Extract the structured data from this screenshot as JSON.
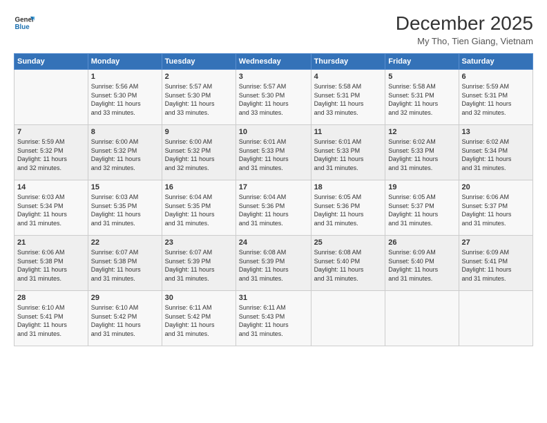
{
  "header": {
    "logo_line1": "General",
    "logo_line2": "Blue",
    "title": "December 2025",
    "location": "My Tho, Tien Giang, Vietnam"
  },
  "days_of_week": [
    "Sunday",
    "Monday",
    "Tuesday",
    "Wednesday",
    "Thursday",
    "Friday",
    "Saturday"
  ],
  "weeks": [
    [
      {
        "day": "",
        "info": ""
      },
      {
        "day": "1",
        "info": "Sunrise: 5:56 AM\nSunset: 5:30 PM\nDaylight: 11 hours\nand 33 minutes."
      },
      {
        "day": "2",
        "info": "Sunrise: 5:57 AM\nSunset: 5:30 PM\nDaylight: 11 hours\nand 33 minutes."
      },
      {
        "day": "3",
        "info": "Sunrise: 5:57 AM\nSunset: 5:30 PM\nDaylight: 11 hours\nand 33 minutes."
      },
      {
        "day": "4",
        "info": "Sunrise: 5:58 AM\nSunset: 5:31 PM\nDaylight: 11 hours\nand 33 minutes."
      },
      {
        "day": "5",
        "info": "Sunrise: 5:58 AM\nSunset: 5:31 PM\nDaylight: 11 hours\nand 32 minutes."
      },
      {
        "day": "6",
        "info": "Sunrise: 5:59 AM\nSunset: 5:31 PM\nDaylight: 11 hours\nand 32 minutes."
      }
    ],
    [
      {
        "day": "7",
        "info": "Sunrise: 5:59 AM\nSunset: 5:32 PM\nDaylight: 11 hours\nand 32 minutes."
      },
      {
        "day": "8",
        "info": "Sunrise: 6:00 AM\nSunset: 5:32 PM\nDaylight: 11 hours\nand 32 minutes."
      },
      {
        "day": "9",
        "info": "Sunrise: 6:00 AM\nSunset: 5:32 PM\nDaylight: 11 hours\nand 32 minutes."
      },
      {
        "day": "10",
        "info": "Sunrise: 6:01 AM\nSunset: 5:33 PM\nDaylight: 11 hours\nand 31 minutes."
      },
      {
        "day": "11",
        "info": "Sunrise: 6:01 AM\nSunset: 5:33 PM\nDaylight: 11 hours\nand 31 minutes."
      },
      {
        "day": "12",
        "info": "Sunrise: 6:02 AM\nSunset: 5:33 PM\nDaylight: 11 hours\nand 31 minutes."
      },
      {
        "day": "13",
        "info": "Sunrise: 6:02 AM\nSunset: 5:34 PM\nDaylight: 11 hours\nand 31 minutes."
      }
    ],
    [
      {
        "day": "14",
        "info": "Sunrise: 6:03 AM\nSunset: 5:34 PM\nDaylight: 11 hours\nand 31 minutes."
      },
      {
        "day": "15",
        "info": "Sunrise: 6:03 AM\nSunset: 5:35 PM\nDaylight: 11 hours\nand 31 minutes."
      },
      {
        "day": "16",
        "info": "Sunrise: 6:04 AM\nSunset: 5:35 PM\nDaylight: 11 hours\nand 31 minutes."
      },
      {
        "day": "17",
        "info": "Sunrise: 6:04 AM\nSunset: 5:36 PM\nDaylight: 11 hours\nand 31 minutes."
      },
      {
        "day": "18",
        "info": "Sunrise: 6:05 AM\nSunset: 5:36 PM\nDaylight: 11 hours\nand 31 minutes."
      },
      {
        "day": "19",
        "info": "Sunrise: 6:05 AM\nSunset: 5:37 PM\nDaylight: 11 hours\nand 31 minutes."
      },
      {
        "day": "20",
        "info": "Sunrise: 6:06 AM\nSunset: 5:37 PM\nDaylight: 11 hours\nand 31 minutes."
      }
    ],
    [
      {
        "day": "21",
        "info": "Sunrise: 6:06 AM\nSunset: 5:38 PM\nDaylight: 11 hours\nand 31 minutes."
      },
      {
        "day": "22",
        "info": "Sunrise: 6:07 AM\nSunset: 5:38 PM\nDaylight: 11 hours\nand 31 minutes."
      },
      {
        "day": "23",
        "info": "Sunrise: 6:07 AM\nSunset: 5:39 PM\nDaylight: 11 hours\nand 31 minutes."
      },
      {
        "day": "24",
        "info": "Sunrise: 6:08 AM\nSunset: 5:39 PM\nDaylight: 11 hours\nand 31 minutes."
      },
      {
        "day": "25",
        "info": "Sunrise: 6:08 AM\nSunset: 5:40 PM\nDaylight: 11 hours\nand 31 minutes."
      },
      {
        "day": "26",
        "info": "Sunrise: 6:09 AM\nSunset: 5:40 PM\nDaylight: 11 hours\nand 31 minutes."
      },
      {
        "day": "27",
        "info": "Sunrise: 6:09 AM\nSunset: 5:41 PM\nDaylight: 11 hours\nand 31 minutes."
      }
    ],
    [
      {
        "day": "28",
        "info": "Sunrise: 6:10 AM\nSunset: 5:41 PM\nDaylight: 11 hours\nand 31 minutes."
      },
      {
        "day": "29",
        "info": "Sunrise: 6:10 AM\nSunset: 5:42 PM\nDaylight: 11 hours\nand 31 minutes."
      },
      {
        "day": "30",
        "info": "Sunrise: 6:11 AM\nSunset: 5:42 PM\nDaylight: 11 hours\nand 31 minutes."
      },
      {
        "day": "31",
        "info": "Sunrise: 6:11 AM\nSunset: 5:43 PM\nDaylight: 11 hours\nand 31 minutes."
      },
      {
        "day": "",
        "info": ""
      },
      {
        "day": "",
        "info": ""
      },
      {
        "day": "",
        "info": ""
      }
    ]
  ]
}
